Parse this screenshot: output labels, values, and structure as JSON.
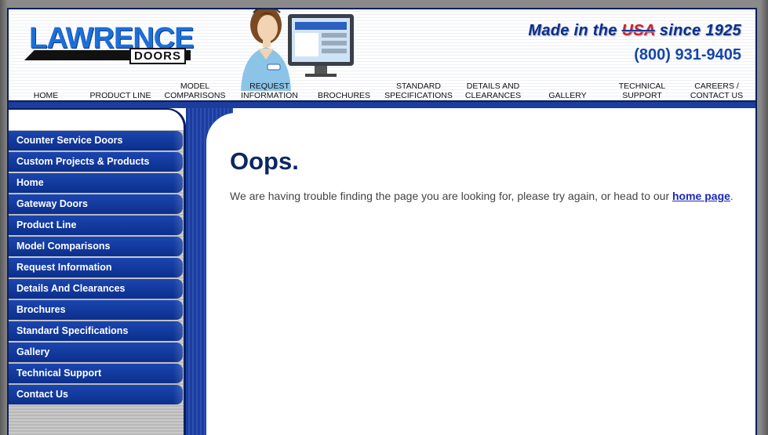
{
  "brand": {
    "logo_main": "LAWRENCE",
    "logo_sub": "DOORS",
    "tagline_prefix": "Made in the ",
    "tagline_usa": "USA",
    "tagline_suffix": " since 1925",
    "phone": "(800) 931-9405"
  },
  "nav": {
    "items": [
      {
        "line1": "",
        "line2": "HOME"
      },
      {
        "line1": "",
        "line2": "PRODUCT LINE"
      },
      {
        "line1": "MODEL",
        "line2": "COMPARISONS"
      },
      {
        "line1": "REQUEST",
        "line2": "INFORMATION"
      },
      {
        "line1": "",
        "line2": "BROCHURES"
      },
      {
        "line1": "STANDARD",
        "line2": "SPECIFICATIONS"
      },
      {
        "line1": "DETAILS AND",
        "line2": "CLEARANCES"
      },
      {
        "line1": "",
        "line2": "GALLERY"
      },
      {
        "line1": "TECHNICAL",
        "line2": "SUPPORT"
      },
      {
        "line1": "CAREERS /",
        "line2": "CONTACT US"
      }
    ]
  },
  "sidebar": {
    "items": [
      "Counter Service Doors",
      "Custom Projects & Products",
      "Home",
      "Gateway Doors",
      "Product Line",
      "Model Comparisons",
      "Request Information",
      "Details And Clearances",
      "Brochures",
      "Standard Specifications",
      "Gallery",
      "Technical Support",
      "Contact Us"
    ]
  },
  "main": {
    "title": "Oops.",
    "message_before": "We are having trouble finding the page you are looking for, please try again, or head to our ",
    "message_link": "home page",
    "message_after": "."
  },
  "colors": {
    "brand_blue": "#0b2f8c",
    "accent_blue": "#1d6fd8",
    "title_navy": "#0b2663",
    "usa_red": "#d32222"
  }
}
